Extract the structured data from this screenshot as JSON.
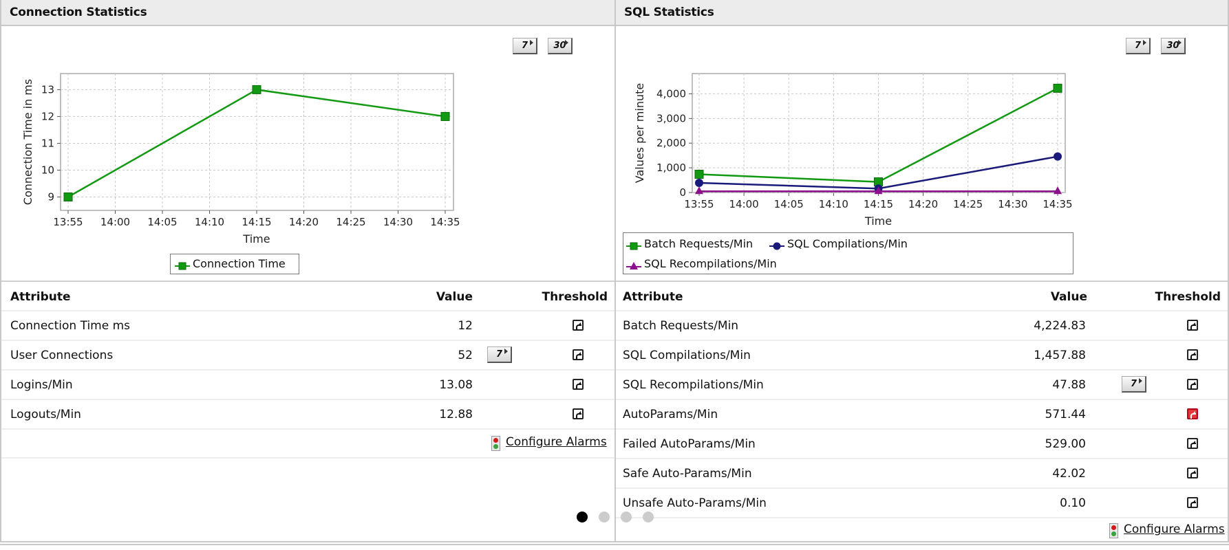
{
  "left_panel": {
    "title": "Connection Statistics",
    "period_buttons": [
      "7",
      "30"
    ],
    "table": {
      "headers": {
        "attribute": "Attribute",
        "value": "Value",
        "threshold": "Threshold"
      },
      "rows": [
        {
          "attribute": "Connection Time ms",
          "value": "12",
          "has_period_button": false,
          "period_label": "",
          "threshold_state": "normal"
        },
        {
          "attribute": "User Connections",
          "value": "52",
          "has_period_button": true,
          "period_label": "7",
          "threshold_state": "normal"
        },
        {
          "attribute": "Logins/Min",
          "value": "13.08",
          "has_period_button": false,
          "period_label": "",
          "threshold_state": "normal"
        },
        {
          "attribute": "Logouts/Min",
          "value": "12.88",
          "has_period_button": false,
          "period_label": "",
          "threshold_state": "normal"
        }
      ]
    },
    "configure_alarms_label": "Configure Alarms"
  },
  "right_panel": {
    "title": "SQL Statistics",
    "period_buttons": [
      "7",
      "30"
    ],
    "table": {
      "headers": {
        "attribute": "Attribute",
        "value": "Value",
        "threshold": "Threshold"
      },
      "rows": [
        {
          "attribute": "Batch Requests/Min",
          "value": "4,224.83",
          "has_period_button": false,
          "period_label": "",
          "threshold_state": "normal"
        },
        {
          "attribute": "SQL Compilations/Min",
          "value": "1,457.88",
          "has_period_button": false,
          "period_label": "",
          "threshold_state": "normal"
        },
        {
          "attribute": "SQL Recompilations/Min",
          "value": "47.88",
          "has_period_button": true,
          "period_label": "7",
          "threshold_state": "normal"
        },
        {
          "attribute": "AutoParams/Min",
          "value": "571.44",
          "has_period_button": false,
          "period_label": "",
          "threshold_state": "alert"
        },
        {
          "attribute": "Failed AutoParams/Min",
          "value": "529.00",
          "has_period_button": false,
          "period_label": "",
          "threshold_state": "normal"
        },
        {
          "attribute": "Safe Auto-Params/Min",
          "value": "42.02",
          "has_period_button": false,
          "period_label": "",
          "threshold_state": "normal"
        },
        {
          "attribute": "Unsafe Auto-Params/Min",
          "value": "0.10",
          "has_period_button": false,
          "period_label": "",
          "threshold_state": "normal"
        }
      ]
    },
    "configure_alarms_label": "Configure Alarms"
  },
  "pagination": {
    "total": 4,
    "active_index": 0
  },
  "colors": {
    "green": "#119911",
    "navy": "#1a1a7a",
    "purple": "#8b108b",
    "alert_red": "#e23a3a"
  },
  "chart_data": [
    {
      "type": "line",
      "title": "",
      "xlabel": "Time",
      "ylabel": "Connection Time in ms",
      "x_ticks": [
        "13:55",
        "14:00",
        "14:05",
        "14:10",
        "14:15",
        "14:20",
        "14:25",
        "14:30",
        "14:35"
      ],
      "y_ticks": [
        9,
        10,
        11,
        12,
        13
      ],
      "ylim": [
        8.5,
        13.6
      ],
      "grid": true,
      "legend_position": "bottom",
      "series": [
        {
          "name": "Connection Time",
          "color": "#119911",
          "marker": "square",
          "x": [
            "13:55",
            "14:15",
            "14:35"
          ],
          "values": [
            9,
            13,
            12
          ]
        }
      ]
    },
    {
      "type": "line",
      "title": "",
      "xlabel": "Time",
      "ylabel": "Values per minute",
      "x_ticks": [
        "13:55",
        "14:00",
        "14:05",
        "14:10",
        "14:15",
        "14:20",
        "14:25",
        "14:30",
        "14:35"
      ],
      "y_ticks": [
        0,
        1000,
        2000,
        3000,
        4000
      ],
      "y_tick_labels": [
        "0",
        "1,000",
        "2,000",
        "3,000",
        "4,000"
      ],
      "ylim": [
        0,
        4820
      ],
      "grid": true,
      "legend_position": "bottom",
      "series": [
        {
          "name": "Batch Requests/Min",
          "color": "#119911",
          "marker": "square",
          "x": [
            "13:55",
            "14:15",
            "14:35"
          ],
          "values": [
            740,
            430,
            4224.83
          ]
        },
        {
          "name": "SQL Compilations/Min",
          "color": "#1a1a7a",
          "marker": "circle",
          "x": [
            "13:55",
            "14:15",
            "14:35"
          ],
          "values": [
            390,
            160,
            1457.88
          ]
        },
        {
          "name": "SQL Recompilations/Min",
          "color": "#8b108b",
          "marker": "triangle",
          "x": [
            "13:55",
            "14:15",
            "14:35"
          ],
          "values": [
            48,
            48,
            47.88
          ]
        }
      ]
    }
  ]
}
